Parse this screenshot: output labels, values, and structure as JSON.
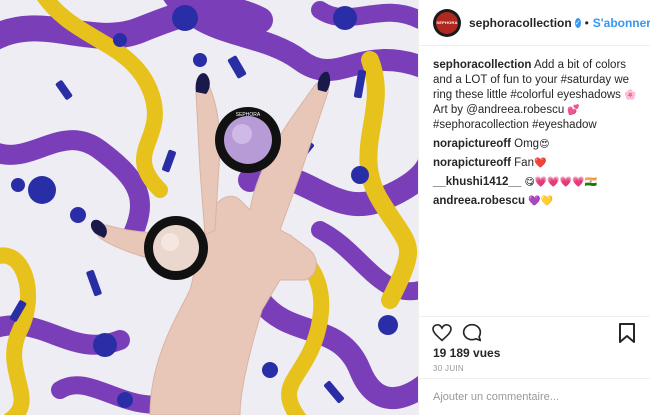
{
  "header": {
    "username": "sephoracollection",
    "avatar_text": "SEPHORA",
    "separator": "•",
    "follow_label": "S'abonner"
  },
  "caption": {
    "username": "sephoracollection",
    "text_1": "Add a bit of colors and a LOT of fun to your #saturday we ring these little #colorful eyeshadows",
    "emoji_1": "🌸",
    "text_2": "Art by @andreea.robescu",
    "emoji_2": "💕",
    "text_3": "#sephoracollection #eyeshadow"
  },
  "comments": [
    {
      "username": "norapictureoff",
      "text": "Omg",
      "emoji": "😍"
    },
    {
      "username": "norapictureoff",
      "text": "Fan",
      "emoji": "❤️"
    },
    {
      "username": "__khushi1412__",
      "text": "",
      "emoji": "😋💗💗💗💗🇮🇳"
    },
    {
      "username": "andreea.robescu",
      "text": "",
      "emoji": "💜💛"
    }
  ],
  "stats": {
    "views": "19 189 vues",
    "date": "30 JUIN"
  },
  "add_comment": {
    "placeholder": "Ajouter un commentaire..."
  },
  "image": {
    "palette_text": "SEPHORA",
    "colors": {
      "purple": "#7a3fb8",
      "navy": "#2a2ea6",
      "yellow": "#e8c21c",
      "bg": "#eceaf1"
    }
  },
  "icons": {
    "like": "heart-icon",
    "comment": "comment-bubble-icon",
    "save": "bookmark-icon",
    "verified": "verified-badge-icon"
  }
}
